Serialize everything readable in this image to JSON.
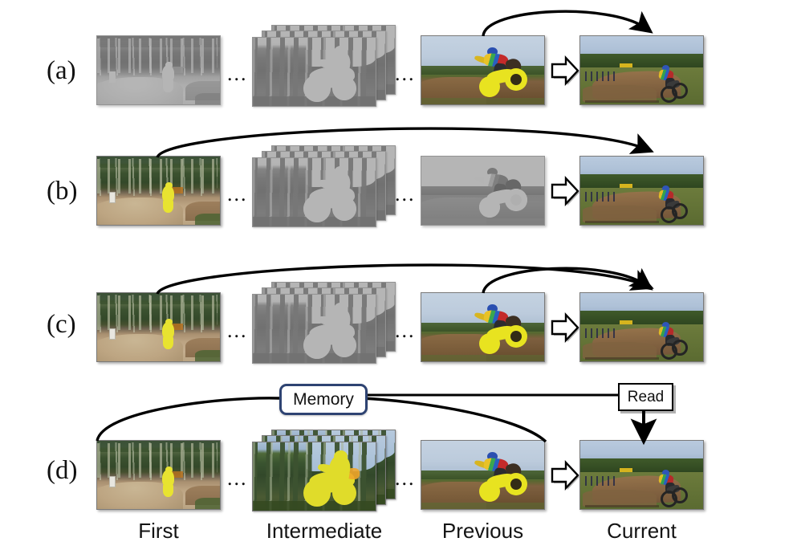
{
  "figure": {
    "title": "Video object segmentation matching strategies",
    "rows": [
      {
        "id": "a",
        "label": "(a)",
        "note": "previous frame to current frame propagation"
      },
      {
        "id": "b",
        "label": "(b)",
        "note": "first frame to current frame matching"
      },
      {
        "id": "c",
        "label": "(c)",
        "note": "first frame and previous frame to current frame"
      },
      {
        "id": "d",
        "label": "(d)",
        "note": "memory of all past frames read by current frame"
      }
    ],
    "columns": [
      {
        "key": "first",
        "caption": "First"
      },
      {
        "key": "intermediate",
        "caption": "Intermediate"
      },
      {
        "key": "previous",
        "caption": "Previous"
      },
      {
        "key": "current",
        "caption": "Current"
      }
    ],
    "ellipsis": "...",
    "memory_box": {
      "label": "Memory",
      "border_color": "#2e4372"
    },
    "read_box": {
      "label": "Read",
      "border_color": "#000000"
    },
    "colors": {
      "mask": "#e8e320",
      "memory_border": "#2e4372",
      "arrow": "#000000",
      "background": "#ffffff"
    },
    "frames": {
      "a": {
        "first": {
          "state": "faded",
          "mask": false
        },
        "intermediate": {
          "state": "faded",
          "mask": false,
          "count": 3
        },
        "previous": {
          "state": "color",
          "mask": true
        },
        "current": {
          "state": "color",
          "mask": false
        }
      },
      "b": {
        "first": {
          "state": "color",
          "mask": true
        },
        "intermediate": {
          "state": "faded",
          "mask": false,
          "count": 3
        },
        "previous": {
          "state": "faded",
          "mask": false
        },
        "current": {
          "state": "color",
          "mask": false
        }
      },
      "c": {
        "first": {
          "state": "color",
          "mask": true
        },
        "intermediate": {
          "state": "faded",
          "mask": false,
          "count": 3
        },
        "previous": {
          "state": "color",
          "mask": true
        },
        "current": {
          "state": "color",
          "mask": false
        }
      },
      "d": {
        "first": {
          "state": "color",
          "mask": true
        },
        "intermediate": {
          "state": "color",
          "mask": true,
          "count": 3
        },
        "previous": {
          "state": "color",
          "mask": true
        },
        "current": {
          "state": "color",
          "mask": false
        }
      }
    }
  }
}
